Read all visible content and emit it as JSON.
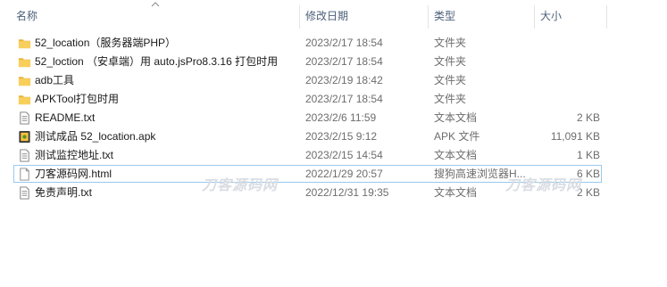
{
  "columns": {
    "name": "名称",
    "date": "修改日期",
    "type": "类型",
    "size": "大小"
  },
  "files": [
    {
      "icon": "folder-icon",
      "name": "52_location（服务器端PHP）",
      "date": "2023/2/17 18:54",
      "type": "文件夹",
      "size": ""
    },
    {
      "icon": "folder-icon",
      "name": "52_loction （安卓端）用 auto.jsPro8.3.16 打包时用",
      "date": "2023/2/17 18:54",
      "type": "文件夹",
      "size": ""
    },
    {
      "icon": "folder-icon",
      "name": "adb工具",
      "date": "2023/2/19 18:42",
      "type": "文件夹",
      "size": ""
    },
    {
      "icon": "folder-icon",
      "name": "APKTool打包时用",
      "date": "2023/2/17 18:54",
      "type": "文件夹",
      "size": ""
    },
    {
      "icon": "text-file-icon",
      "name": "README.txt",
      "date": "2023/2/6 11:59",
      "type": "文本文档",
      "size": "2 KB"
    },
    {
      "icon": "apk-file-icon",
      "name": "测试成品 52_location.apk",
      "date": "2023/2/15 9:12",
      "type": "APK 文件",
      "size": "11,091 KB"
    },
    {
      "icon": "text-file-icon",
      "name": "测试监控地址.txt",
      "date": "2023/2/15 14:54",
      "type": "文本文档",
      "size": "1 KB"
    },
    {
      "icon": "html-file-icon",
      "name": "刀客源码网.html",
      "date": "2022/1/29 20:57",
      "type": "搜狗高速浏览器H...",
      "size": "6 KB"
    },
    {
      "icon": "text-file-icon",
      "name": "免责声明.txt",
      "date": "2022/12/31 19:35",
      "type": "文本文档",
      "size": "2 KB"
    }
  ],
  "watermark": "刀客源码网",
  "colors": {
    "header_text": "#4c607a",
    "detail_text": "#6d6d6d",
    "selection_border": "#99c9ef",
    "folder": "#f5c342"
  }
}
